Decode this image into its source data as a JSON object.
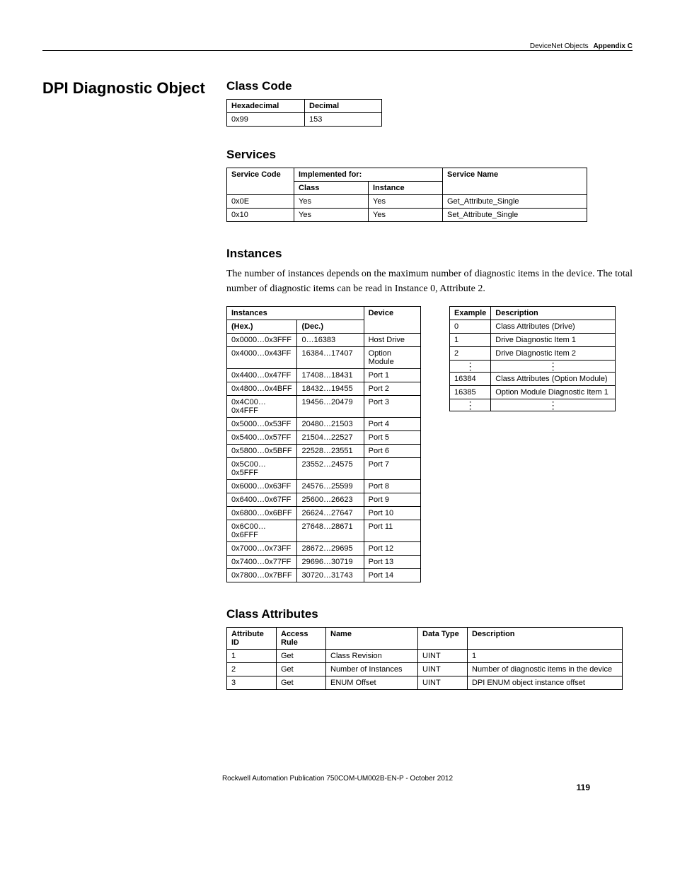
{
  "header": {
    "doc_section": "DeviceNet Objects",
    "appendix": "Appendix C"
  },
  "title": "DPI Diagnostic Object",
  "class_code": {
    "heading": "Class Code",
    "cols": [
      "Hexadecimal",
      "Decimal"
    ],
    "row": [
      "0x99",
      "153"
    ]
  },
  "services": {
    "heading": "Services",
    "h_service_code": "Service Code",
    "h_impl": "Implemented for:",
    "h_class": "Class",
    "h_instance": "Instance",
    "h_name": "Service Name",
    "rows": [
      {
        "code": "0x0E",
        "cls": "Yes",
        "inst": "Yes",
        "name": "Get_Attribute_Single"
      },
      {
        "code": "0x10",
        "cls": "Yes",
        "inst": "Yes",
        "name": "Set_Attribute_Single"
      }
    ]
  },
  "instances": {
    "heading": "Instances",
    "body": "The number of instances depends on the maximum number of diagnostic items in the device. The total number of diagnostic items can be read in Instance 0, Attribute 2.",
    "h_instances": "Instances",
    "h_device": "Device",
    "h_hex": "(Hex.)",
    "h_dec": "(Dec.)",
    "rows": [
      {
        "hex": "0x0000…0x3FFF",
        "dec": "0…16383",
        "dev": "Host Drive"
      },
      {
        "hex": "0x4000…0x43FF",
        "dec": "16384…17407",
        "dev": "Option Module"
      },
      {
        "hex": "0x4400…0x47FF",
        "dec": "17408…18431",
        "dev": "Port 1"
      },
      {
        "hex": "0x4800…0x4BFF",
        "dec": "18432…19455",
        "dev": "Port 2"
      },
      {
        "hex": "0x4C00…0x4FFF",
        "dec": "19456…20479",
        "dev": "Port 3"
      },
      {
        "hex": "0x5000…0x53FF",
        "dec": "20480…21503",
        "dev": "Port 4"
      },
      {
        "hex": "0x5400…0x57FF",
        "dec": "21504…22527",
        "dev": "Port 5"
      },
      {
        "hex": "0x5800…0x5BFF",
        "dec": "22528…23551",
        "dev": "Port 6"
      },
      {
        "hex": "0x5C00…0x5FFF",
        "dec": "23552…24575",
        "dev": "Port 7"
      },
      {
        "hex": "0x6000…0x63FF",
        "dec": "24576…25599",
        "dev": "Port 8"
      },
      {
        "hex": "0x6400…0x67FF",
        "dec": "25600…26623",
        "dev": "Port 9"
      },
      {
        "hex": "0x6800…0x6BFF",
        "dec": "26624…27647",
        "dev": "Port 10"
      },
      {
        "hex": "0x6C00…0x6FFF",
        "dec": "27648…28671",
        "dev": "Port 11"
      },
      {
        "hex": "0x7000…0x73FF",
        "dec": "28672…29695",
        "dev": "Port 12"
      },
      {
        "hex": "0x7400…0x77FF",
        "dec": "29696…30719",
        "dev": "Port 13"
      },
      {
        "hex": "0x7800…0x7BFF",
        "dec": "30720…31743",
        "dev": "Port 14"
      }
    ],
    "example": {
      "h_example": "Example",
      "h_desc": "Description",
      "rows": [
        {
          "ex": "0",
          "desc": "Class Attributes (Drive)"
        },
        {
          "ex": "1",
          "desc": "Drive Diagnostic Item 1"
        },
        {
          "ex": "2",
          "desc": "Drive Diagnostic Item 2"
        },
        {
          "ex": "⋮",
          "desc": "⋮",
          "dots": true
        },
        {
          "ex": "16384",
          "desc": "Class Attributes (Option Module)"
        },
        {
          "ex": "16385",
          "desc": "Option Module Diagnostic Item 1"
        },
        {
          "ex": "⋮",
          "desc": "⋮",
          "dots": true
        }
      ]
    }
  },
  "class_attributes": {
    "heading": "Class Attributes",
    "cols": [
      "Attribute ID",
      "Access Rule",
      "Name",
      "Data Type",
      "Description"
    ],
    "rows": [
      {
        "id": "1",
        "rule": "Get",
        "name": "Class Revision",
        "dt": "UINT",
        "desc": "1"
      },
      {
        "id": "2",
        "rule": "Get",
        "name": "Number of Instances",
        "dt": "UINT",
        "desc": "Number of diagnostic items in the device"
      },
      {
        "id": "3",
        "rule": "Get",
        "name": "ENUM Offset",
        "dt": "UINT",
        "desc": "DPI ENUM object instance offset"
      }
    ]
  },
  "footer": {
    "pub": "Rockwell Automation Publication 750COM-UM002B-EN-P - October 2012",
    "page": "119"
  }
}
